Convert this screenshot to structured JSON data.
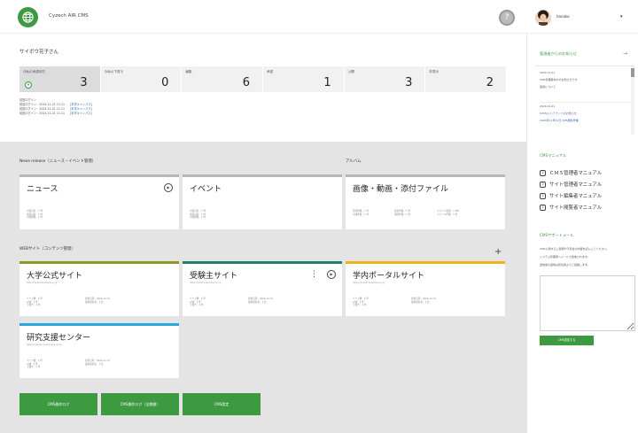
{
  "header": {
    "app_name": "Cyzech AIR CMS",
    "help_label": "?",
    "user_name": "hanako",
    "caret": "▾",
    "brand_color": "#3d9a41"
  },
  "summary": {
    "greeting": "サイボウ花子さん",
    "stats": [
      {
        "label": "今私の承認待ち",
        "value": "3",
        "toggle": "▾"
      },
      {
        "label": "今私の下書き",
        "value": "0"
      },
      {
        "label": "編集",
        "value": "6"
      },
      {
        "label": "承認",
        "value": "1"
      },
      {
        "label": "公開",
        "value": "3"
      },
      {
        "label": "非表示",
        "value": "2"
      }
    ],
    "login_title": "前回ログイン",
    "logins": [
      {
        "text": "前回ログイン：2024-11-21 11:11",
        "link": "[本学キャンパス]"
      },
      {
        "text": "前回ログイン：2024-11-21 11:11",
        "link": "[本学キャンパス]"
      },
      {
        "text": "前回ログイン：2024-11-21 11:11",
        "link": "[本学キャンパス]"
      }
    ]
  },
  "news_section": {
    "title": "News release（ニュース・イベント管理）",
    "cards": [
      {
        "title": "ニュース",
        "play": "▶",
        "meta": [
          "公開日時：1 件",
          "更新日時：1 件",
          "公開期限：1 件"
        ]
      },
      {
        "title": "イベント",
        "meta": [
          "公開日時：1 件",
          "更新日時：1 件",
          "公開期限：1 件"
        ]
      }
    ]
  },
  "album_section": {
    "title": "アルバム",
    "card": {
      "title": "画像・動画・添付ファイル",
      "meta_left": [
        "登録件数：1 件",
        "公開件数：1 件"
      ],
      "meta_mid": [
        "更新件数：1 件",
        "削除件数：1 件"
      ],
      "meta_right": [
        "ファイル容量：1 MB",
        "ファイル件数：1 件"
      ]
    }
  },
  "web_section": {
    "title": "WEBサイト（コンテンツ管理）",
    "plus": "+",
    "sites": [
      {
        "title": "大学公式サイト",
        "sub": "https://www.example.ac.jp",
        "meta_left": [
          "ページ数：1 件",
          "公開：1 件",
          "下書き：1 件"
        ],
        "meta_right": [
          "更新日時：2024-11-21",
          "最終更新者：1 名"
        ],
        "accent": "#8a9a23"
      },
      {
        "title": "受験主サイト",
        "sub": "https://exam.example.ac.jp",
        "meta_left": [
          "ページ数：1 件",
          "公開：1 件",
          "下書き：1 件"
        ],
        "meta_right": [
          "更新日時：2024-11-21",
          "最終更新者：1 名"
        ],
        "accent": "#1f7f6b",
        "kebab": "⋮",
        "play": "▶"
      },
      {
        "title": "学内ポータルサイト",
        "sub": "https://portal.example.ac.jp",
        "meta_left": [
          "ページ数：1 件",
          "公開：1 件",
          "下書き：1 件"
        ],
        "meta_right": [
          "更新日時：2024-11-21",
          "最終更新者：1 名"
        ],
        "accent": "#f2b01e"
      },
      {
        "title": "研究支援センター",
        "sub": "https://research.example.ac.jp",
        "meta_left": [
          "ページ数：1 件",
          "公開：1 件",
          "下書き：1 件"
        ],
        "meta_right": [
          "更新日時：2024-11-21",
          "最終更新者：1 名"
        ],
        "accent": "#2aa7de"
      }
    ]
  },
  "buttons": {
    "log": "CMS操作ログ",
    "log_detail": "CMS操作ログ（全期間）",
    "settings": "CMS設定"
  },
  "right_panel": {
    "notice_title": "管理者からのお知らせ",
    "collapse": "→",
    "notices": [
      {
        "date": "2024.11.21",
        "text": "CMS管理者向けのお知らせです"
      },
      {
        "date": "",
        "text": "運用について"
      },
      {
        "date": "2024.11.21",
        "text": "[CMS]メンテナンスのお知らせ"
      },
      {
        "date": "",
        "text": "2024年11月21日 CMS更新作業"
      }
    ],
    "manual_title": "CMSマニュアル",
    "manuals": [
      "ＣＭＳ管理者マニュアル",
      "サイト管理者マニュアル",
      "サイト編集者マニュアル",
      "サイト閲覧者マニュアル"
    ],
    "support_title": "CMSサポートメール",
    "support_lines": [
      "CMSに関するご質問や不具合の内容を記入してください。",
      "システム管理者へメールで送信されます。",
      "送信後の返信は担当者よりご連絡します。"
    ],
    "send_label": "CMS送信する"
  }
}
